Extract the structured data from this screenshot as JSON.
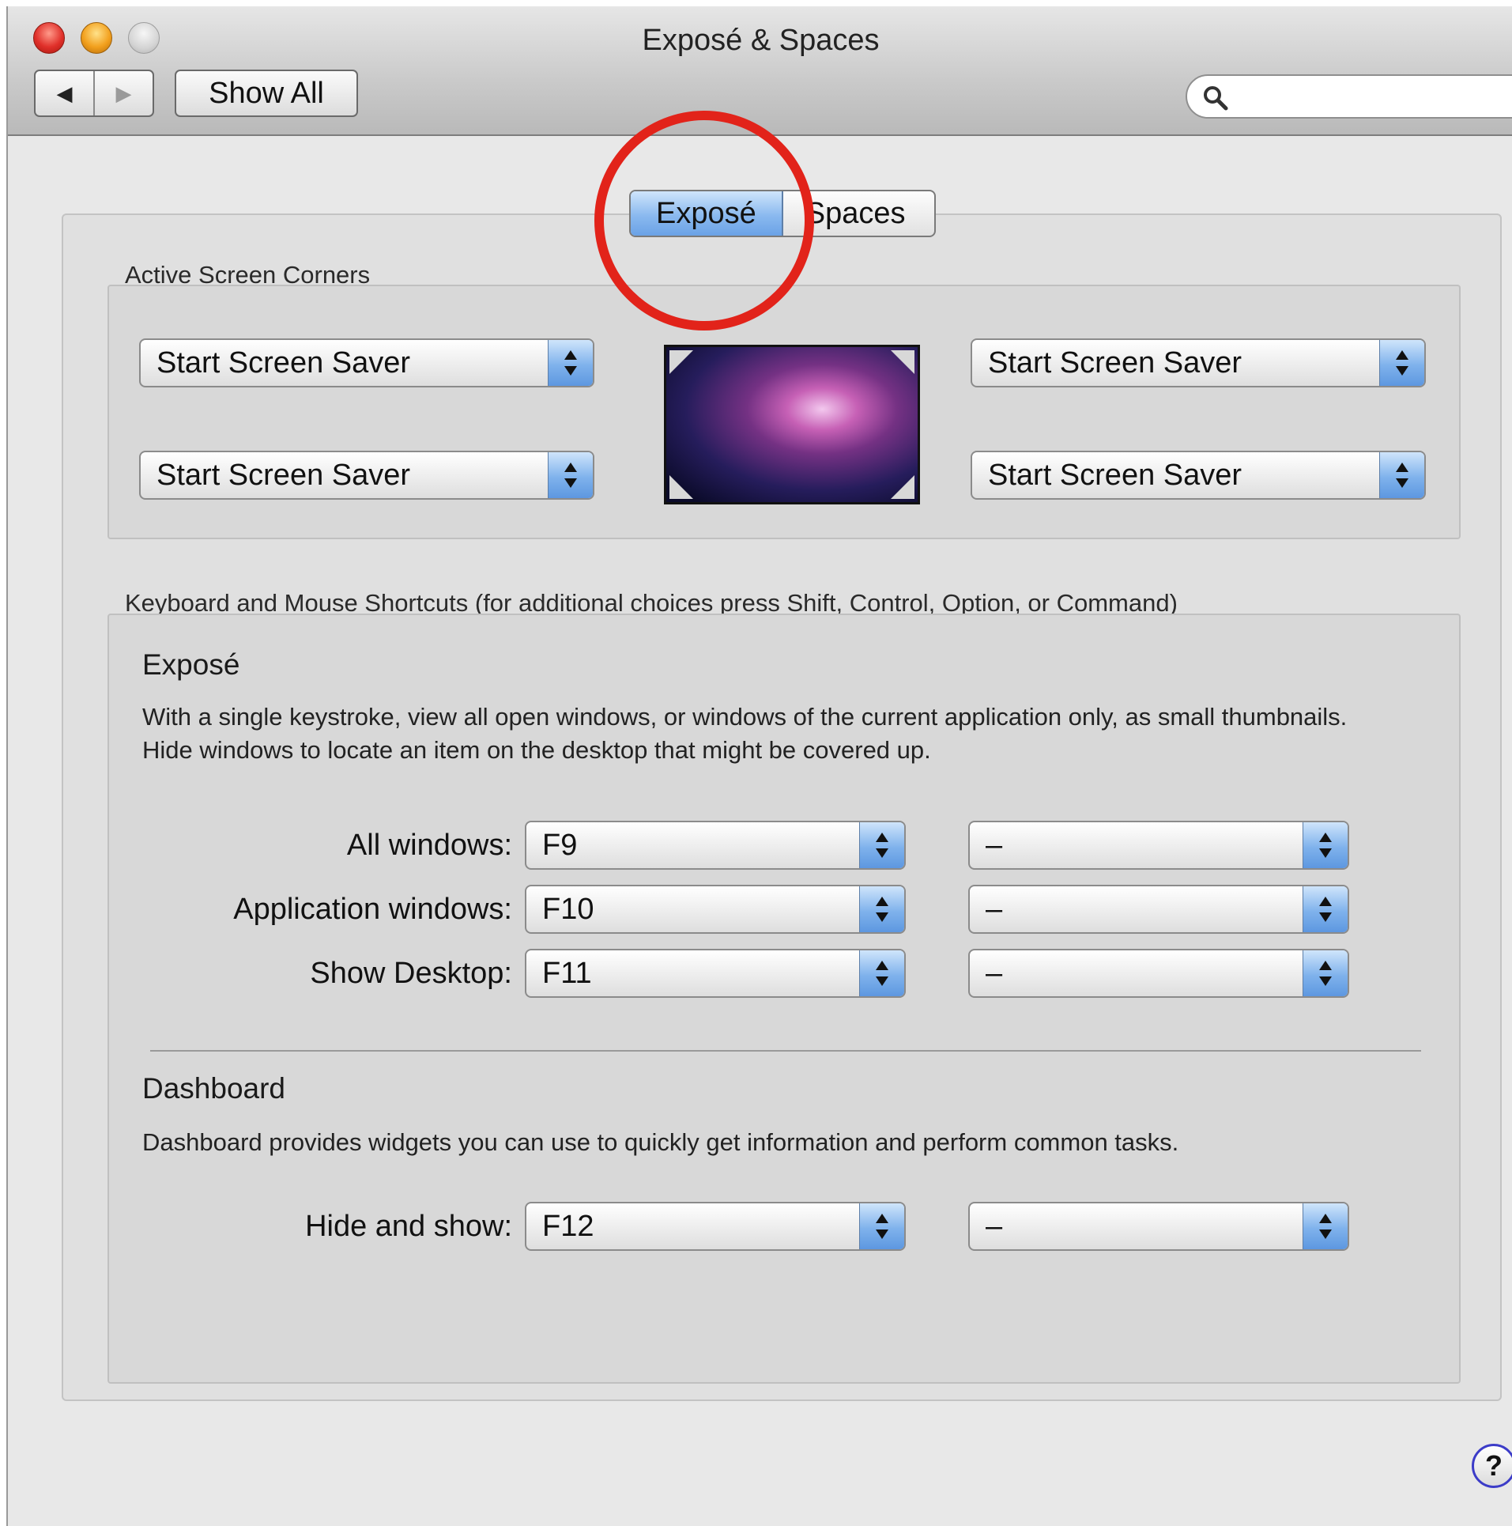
{
  "window": {
    "title": "Exposé & Spaces",
    "nav_back_icon": "◀",
    "nav_forward_icon": "▶",
    "show_all_label": "Show All",
    "search_placeholder": ""
  },
  "tabs": [
    {
      "label": "Exposé",
      "selected": true
    },
    {
      "label": "Spaces",
      "selected": false
    }
  ],
  "active_corners": {
    "label": "Active Screen Corners",
    "top_left": "Start Screen Saver",
    "bottom_left": "Start Screen Saver",
    "top_right": "Start Screen Saver",
    "bottom_right": "Start Screen Saver"
  },
  "shortcuts": {
    "label": "Keyboard and Mouse Shortcuts (for additional choices press Shift, Control, Option, or Command)",
    "expose": {
      "title": "Exposé",
      "description": "With a single keystroke, view all open windows, or windows of the current application only, as small thumbnails. Hide windows to locate an item on the desktop that might be covered up.",
      "rows": [
        {
          "label": "All windows:",
          "key": "F9",
          "mouse": "–"
        },
        {
          "label": "Application windows:",
          "key": "F10",
          "mouse": "–"
        },
        {
          "label": "Show Desktop:",
          "key": "F11",
          "mouse": "–"
        }
      ]
    },
    "dashboard": {
      "title": "Dashboard",
      "description": "Dashboard provides widgets you can use to quickly get information and perform common tasks.",
      "rows": [
        {
          "label": "Hide and show:",
          "key": "F12",
          "mouse": "–"
        }
      ]
    }
  },
  "help_label": "?",
  "colors": {
    "selection_blue": "#7fb2ec",
    "annotation_red": "#e2231a"
  }
}
